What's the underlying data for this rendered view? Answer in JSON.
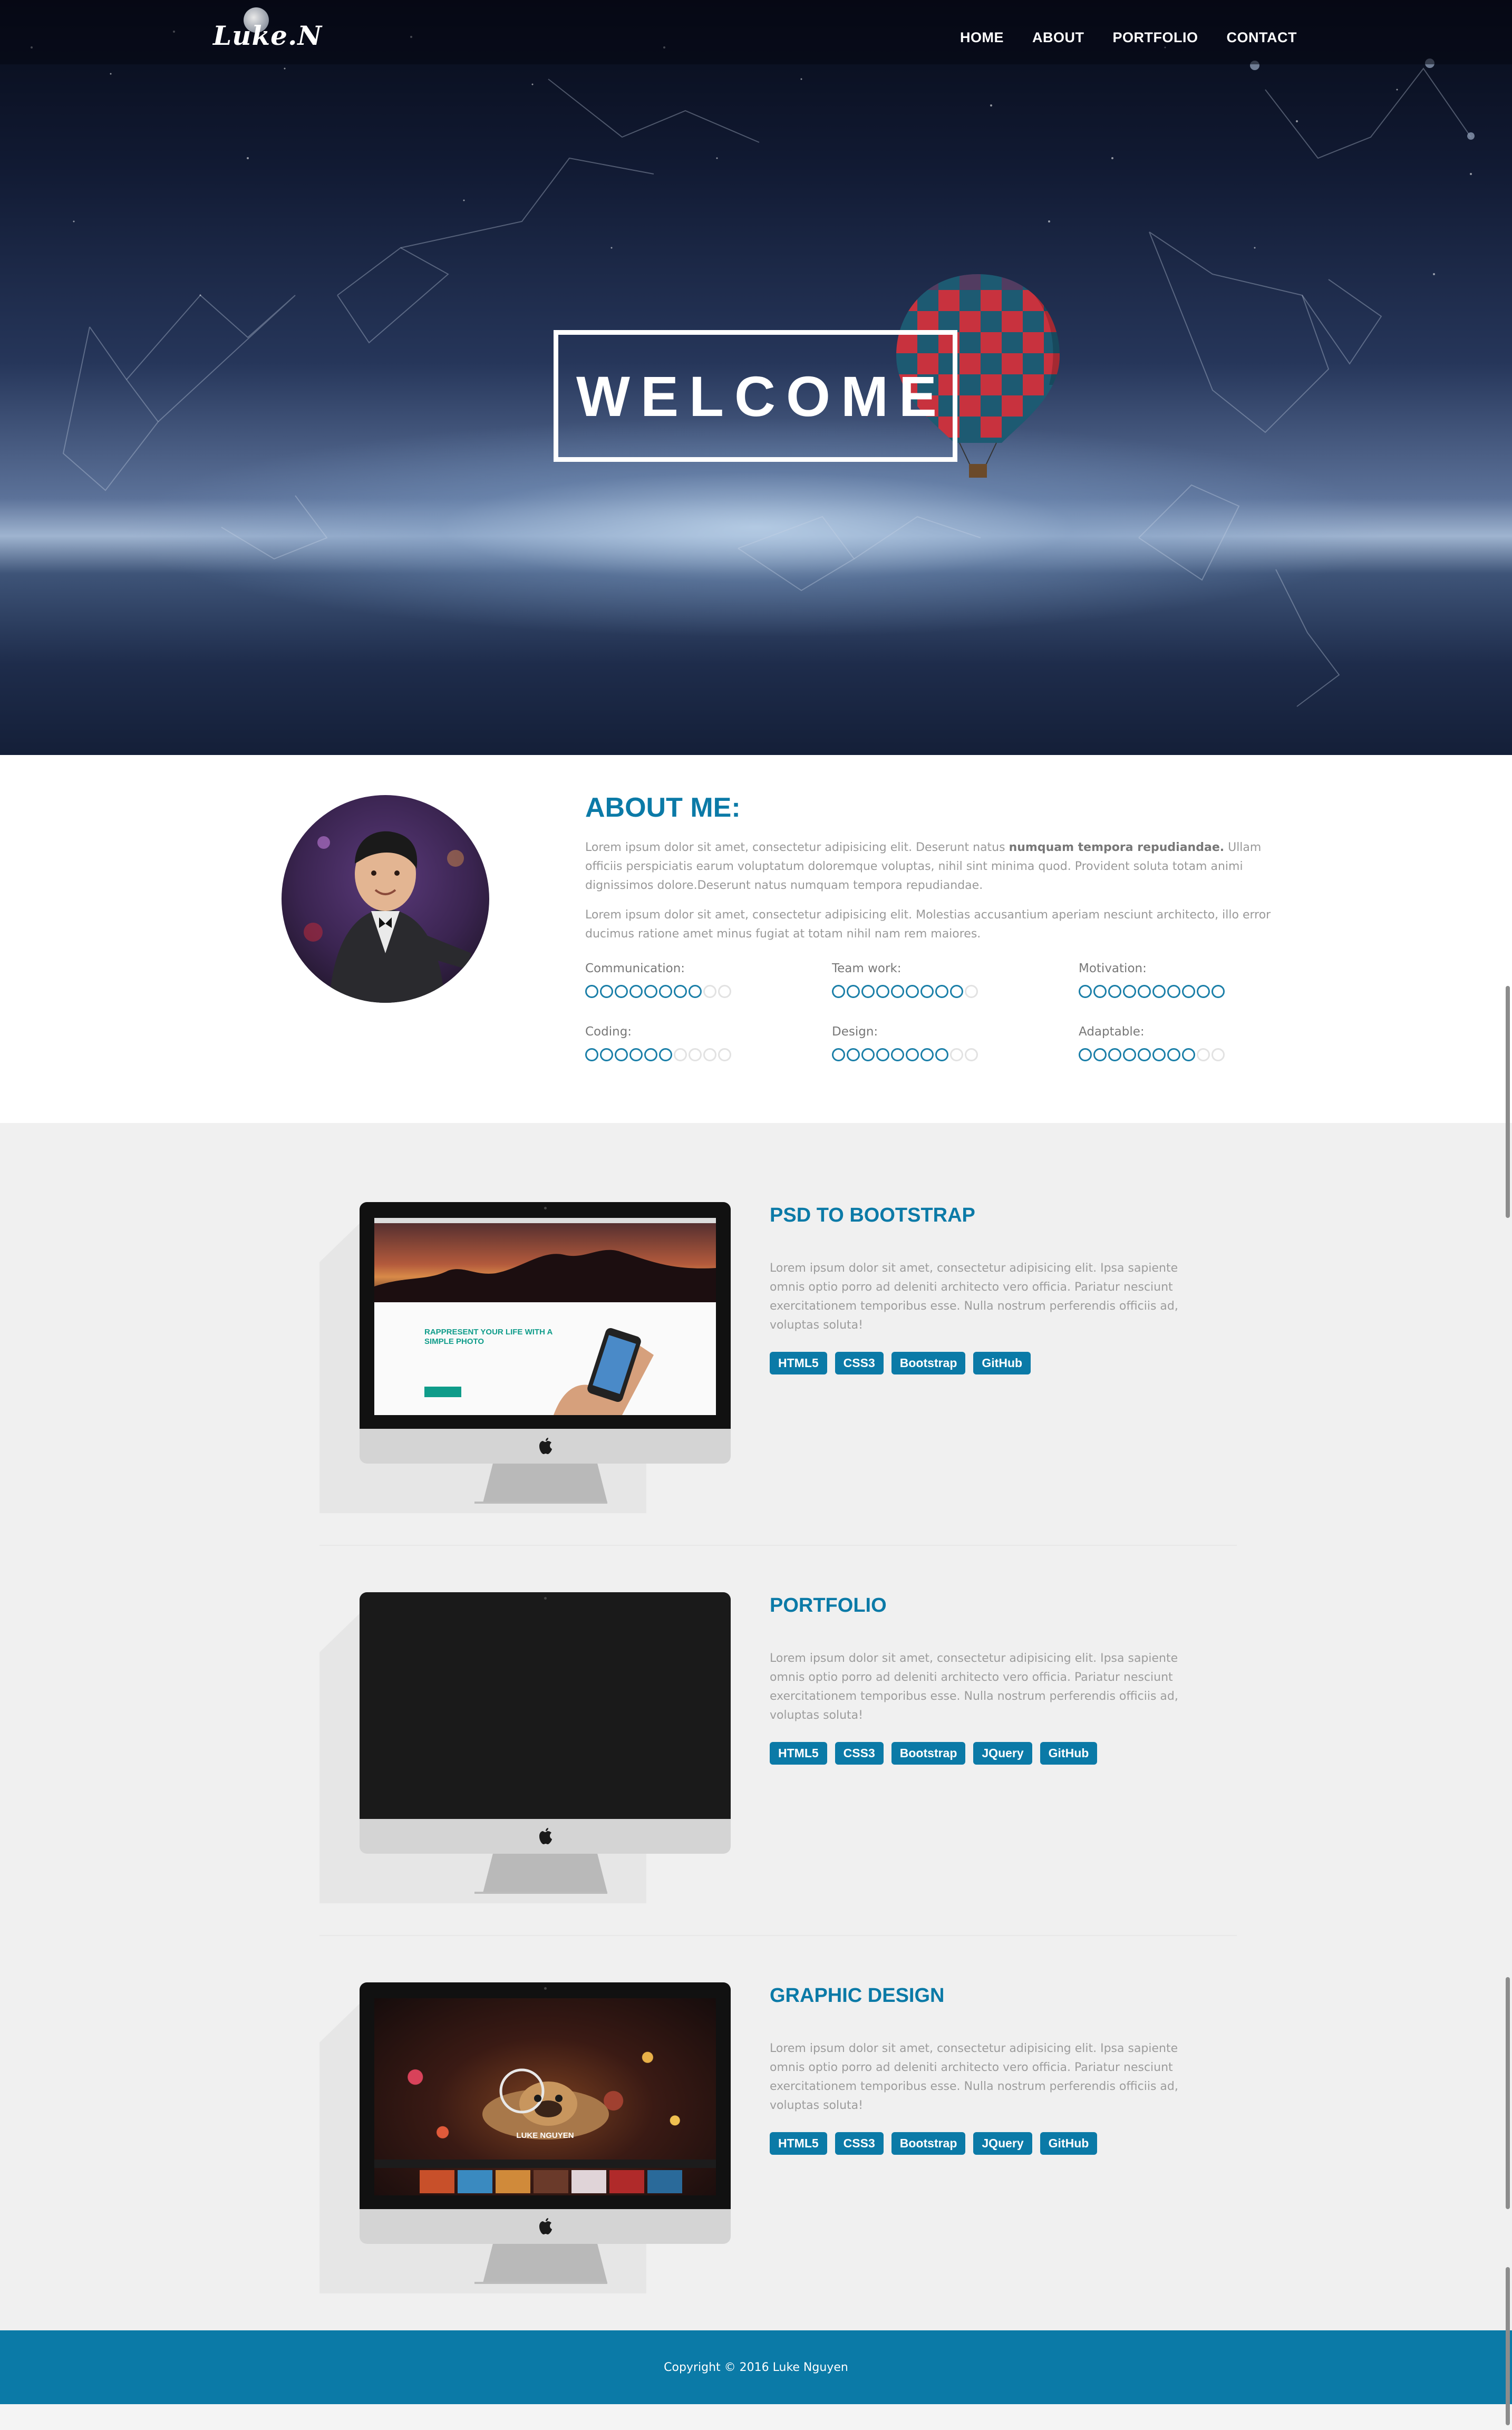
{
  "nav": {
    "logo": "Luke.N",
    "links": [
      "HOME",
      "ABOUT",
      "PORTFOLIO",
      "CONTACT"
    ]
  },
  "hero": {
    "title": "WELCOME"
  },
  "about": {
    "heading": "ABOUT ME:",
    "para1_a": "Lorem ipsum dolor sit amet, consectetur adipisicing elit. Deserunt natus ",
    "para1_bold": "numquam tempora repudiandae.",
    "para1_b": " Ullam officiis perspiciatis earum voluptatum doloremque voluptas, nihil sint minima quod. Provident soluta totam animi dignissimos dolore.Deserunt natus numquam tempora repudiandae.",
    "para2": "Lorem ipsum dolor sit amet, consectetur adipisicing elit. Molestias accusantium aperiam nesciunt architecto, illo error ducimus ratione amet minus fugiat at totam nihil nam rem maiores.",
    "skills": [
      {
        "label": "Communication:",
        "level": 8,
        "max": 10
      },
      {
        "label": "Team work:",
        "level": 9,
        "max": 10
      },
      {
        "label": "Motivation:",
        "level": 10,
        "max": 10
      },
      {
        "label": "Coding:",
        "level": 6,
        "max": 10
      },
      {
        "label": "Design:",
        "level": 8,
        "max": 10
      },
      {
        "label": "Adaptable:",
        "level": 8,
        "max": 10
      }
    ]
  },
  "projects": [
    {
      "title": "PSD TO BOOTSTRAP",
      "desc": "Lorem ipsum dolor sit amet, consectetur adipisicing elit. Ipsa sapiente omnis optio porro ad deleniti architecto vero officia. Pariatur nesciunt exercitationem temporibus esse. Nulla nostrum perferendis officiis ad, voluptas soluta!",
      "tags": [
        "HTML5",
        "CSS3",
        "Bootstrap",
        "GitHub"
      ],
      "screen": {
        "headline": "RAPPRESENT YOUR LIFE WITH A SIMPLE PHOTO"
      }
    },
    {
      "title": "PORTFOLIO",
      "desc": "Lorem ipsum dolor sit amet, consectetur adipisicing elit. Ipsa sapiente omnis optio porro ad deleniti architecto vero officia. Pariatur nesciunt exercitationem temporibus esse. Nulla nostrum perferendis officiis ad, voluptas soluta!",
      "tags": [
        "HTML5",
        "CSS3",
        "Bootstrap",
        "JQuery",
        "GitHub"
      ]
    },
    {
      "title": "GRAPHIC DESIGN",
      "desc": "Lorem ipsum dolor sit amet, consectetur adipisicing elit. Ipsa sapiente omnis optio porro ad deleniti architecto vero officia. Pariatur nesciunt exercitationem temporibus esse. Nulla nostrum perferendis officiis ad, voluptas soluta!",
      "tags": [
        "HTML5",
        "CSS3",
        "Bootstrap",
        "JQuery",
        "GitHub"
      ],
      "screen": {
        "name": "LUKE NGUYEN"
      }
    }
  ],
  "footer": {
    "copyright": "Copyright © 2016 Luke Nguyen"
  },
  "colors": {
    "accent": "#0b7aa7",
    "skill_dot": "#1b7fa8",
    "section_bg": "#f0f0f0"
  }
}
